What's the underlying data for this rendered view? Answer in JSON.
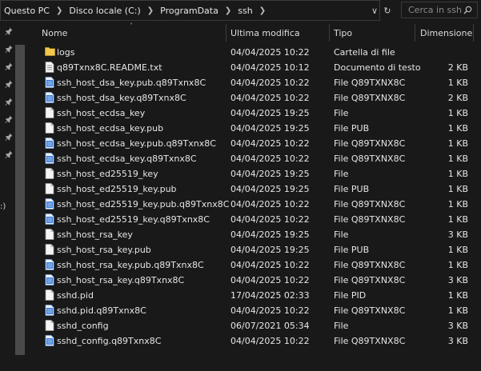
{
  "address": {
    "crumbs": [
      "Questo PC",
      "Disco locale (C:)",
      "ProgramData",
      "ssh"
    ],
    "search_placeholder": "Cerca in ssh"
  },
  "nav": {
    "partial_label": ":)"
  },
  "columns": {
    "name": "Nome",
    "modified": "Ultima modifica",
    "type": "Tipo",
    "size": "Dimensione"
  },
  "files": [
    {
      "name": "logs",
      "date": "04/04/2025 10:22",
      "type": "Cartella di file",
      "size": "",
      "icon": "folder-icon"
    },
    {
      "name": "q89Txnx8C.README.txt",
      "date": "04/04/2025 10:12",
      "type": "Documento di testo",
      "size": "2 KB",
      "icon": "text-file-icon"
    },
    {
      "name": "ssh_host_dsa_key.pub.q89Txnx8C",
      "date": "04/04/2025 10:22",
      "type": "File Q89TXNX8C",
      "size": "1 KB",
      "icon": "encrypted-file-icon"
    },
    {
      "name": "ssh_host_dsa_key.q89Txnx8C",
      "date": "04/04/2025 10:22",
      "type": "File Q89TXNX8C",
      "size": "2 KB",
      "icon": "encrypted-file-icon"
    },
    {
      "name": "ssh_host_ecdsa_key",
      "date": "04/04/2025 19:25",
      "type": "File",
      "size": "1 KB",
      "icon": "blank-file-icon"
    },
    {
      "name": "ssh_host_ecdsa_key.pub",
      "date": "04/04/2025 19:25",
      "type": "File PUB",
      "size": "1 KB",
      "icon": "blank-file-icon"
    },
    {
      "name": "ssh_host_ecdsa_key.pub.q89Txnx8C",
      "date": "04/04/2025 10:22",
      "type": "File Q89TXNX8C",
      "size": "1 KB",
      "icon": "encrypted-file-icon"
    },
    {
      "name": "ssh_host_ecdsa_key.q89Txnx8C",
      "date": "04/04/2025 10:22",
      "type": "File Q89TXNX8C",
      "size": "1 KB",
      "icon": "encrypted-file-icon"
    },
    {
      "name": "ssh_host_ed25519_key",
      "date": "04/04/2025 19:25",
      "type": "File",
      "size": "1 KB",
      "icon": "blank-file-icon"
    },
    {
      "name": "ssh_host_ed25519_key.pub",
      "date": "04/04/2025 19:25",
      "type": "File PUB",
      "size": "1 KB",
      "icon": "blank-file-icon"
    },
    {
      "name": "ssh_host_ed25519_key.pub.q89Txnx8C",
      "date": "04/04/2025 10:22",
      "type": "File Q89TXNX8C",
      "size": "1 KB",
      "icon": "encrypted-file-icon"
    },
    {
      "name": "ssh_host_ed25519_key.q89Txnx8C",
      "date": "04/04/2025 10:22",
      "type": "File Q89TXNX8C",
      "size": "1 KB",
      "icon": "encrypted-file-icon"
    },
    {
      "name": "ssh_host_rsa_key",
      "date": "04/04/2025 19:25",
      "type": "File",
      "size": "3 KB",
      "icon": "blank-file-icon"
    },
    {
      "name": "ssh_host_rsa_key.pub",
      "date": "04/04/2025 19:25",
      "type": "File PUB",
      "size": "1 KB",
      "icon": "blank-file-icon"
    },
    {
      "name": "ssh_host_rsa_key.pub.q89Txnx8C",
      "date": "04/04/2025 10:22",
      "type": "File Q89TXNX8C",
      "size": "1 KB",
      "icon": "encrypted-file-icon"
    },
    {
      "name": "ssh_host_rsa_key.q89Txnx8C",
      "date": "04/04/2025 10:22",
      "type": "File Q89TXNX8C",
      "size": "3 KB",
      "icon": "encrypted-file-icon"
    },
    {
      "name": "sshd.pid",
      "date": "17/04/2025 02:33",
      "type": "File PID",
      "size": "1 KB",
      "icon": "blank-file-icon"
    },
    {
      "name": "sshd.pid.q89Txnx8C",
      "date": "04/04/2025 10:22",
      "type": "File Q89TXNX8C",
      "size": "1 KB",
      "icon": "encrypted-file-icon"
    },
    {
      "name": "sshd_config",
      "date": "06/07/2021 05:34",
      "type": "File",
      "size": "3 KB",
      "icon": "blank-file-icon"
    },
    {
      "name": "sshd_config.q89Txnx8C",
      "date": "04/04/2025 10:22",
      "type": "File Q89TXNX8C",
      "size": "3 KB",
      "icon": "encrypted-file-icon"
    }
  ],
  "colors": {
    "background": "#191919",
    "folder": "#f2c94c",
    "encrypted_icon": "#3a7bd5"
  }
}
